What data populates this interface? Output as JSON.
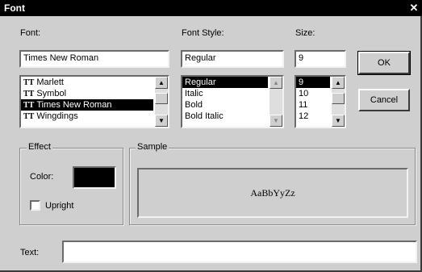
{
  "window": {
    "title": "Font",
    "close_label": "✕"
  },
  "font": {
    "label": "Font:",
    "value": "Times New Roman",
    "items": [
      {
        "label": "Marlett",
        "selected": false
      },
      {
        "label": "Symbol",
        "selected": false
      },
      {
        "label": "Times New Roman",
        "selected": true
      },
      {
        "label": "Wingdings",
        "selected": false
      }
    ]
  },
  "font_style": {
    "label": "Font Style:",
    "value": "Regular",
    "items": [
      {
        "label": "Regular",
        "selected": true
      },
      {
        "label": "Italic",
        "selected": false
      },
      {
        "label": "Bold",
        "selected": false
      },
      {
        "label": "Bold Italic",
        "selected": false
      }
    ]
  },
  "size": {
    "label": "Size:",
    "value": "9",
    "items": [
      {
        "label": "9",
        "selected": true
      },
      {
        "label": "10",
        "selected": false
      },
      {
        "label": "11",
        "selected": false
      },
      {
        "label": "12",
        "selected": false
      }
    ]
  },
  "buttons": {
    "ok": "OK",
    "cancel": "Cancel"
  },
  "effect": {
    "label": "Effect",
    "color_label": "Color:",
    "color_value": "#000000",
    "upright_label": "Upright",
    "upright_checked": false
  },
  "sample": {
    "label": "Sample",
    "text": "AaBbYyZz"
  },
  "text_field": {
    "label": "Text:",
    "value": ""
  },
  "icons": {
    "truetype": "TT",
    "scroll_up": "▲",
    "scroll_down": "▼"
  }
}
